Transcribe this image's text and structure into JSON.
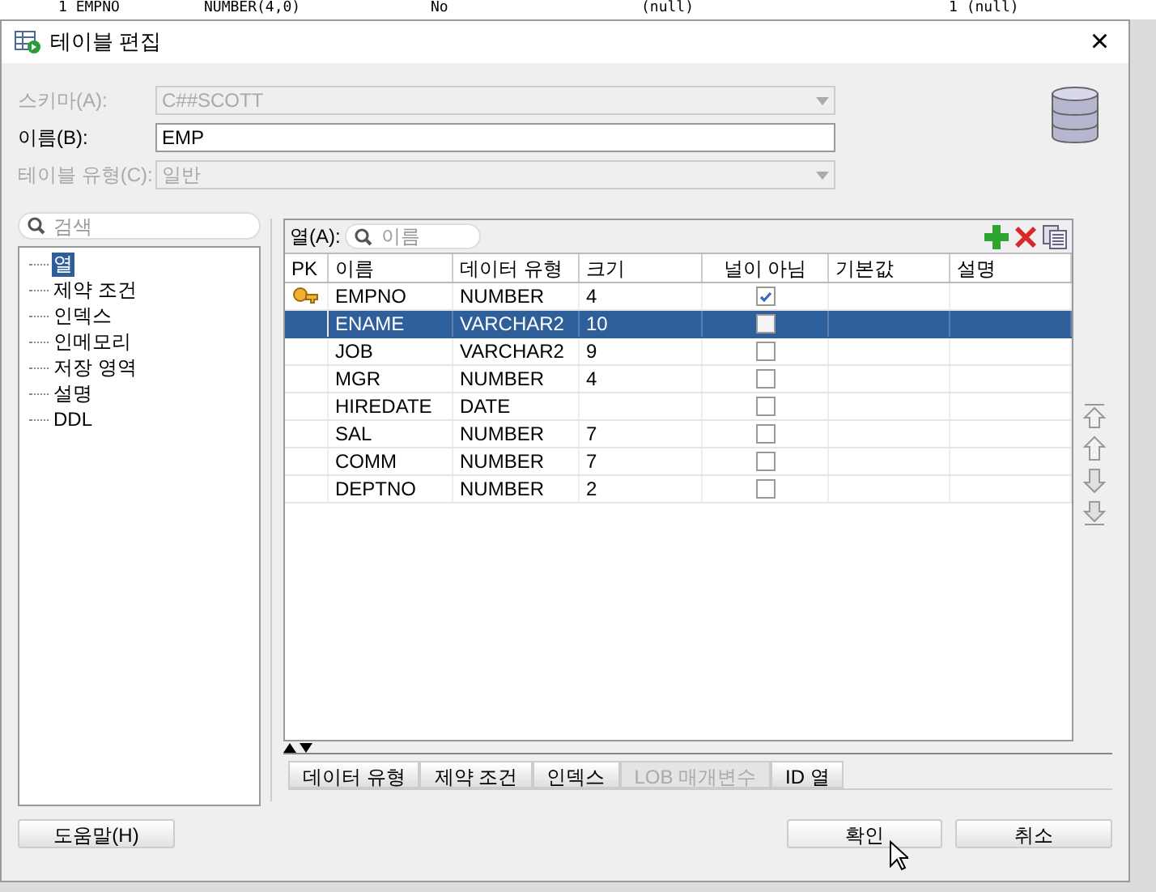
{
  "background_row": {
    "cells": [
      "1 EMPNO",
      "NUMBER(4,0)",
      "No",
      "(null)",
      "1 (null)"
    ]
  },
  "window": {
    "title": "테이블 편집",
    "close": "×"
  },
  "form": [
    {
      "label": "스키마(A):",
      "value": "C##SCOTT",
      "disabled": true,
      "kind": "dropdown"
    },
    {
      "label": "이름(B):",
      "value": "EMP",
      "disabled": false,
      "kind": "text"
    },
    {
      "label": "테이블 유형(C):",
      "value": "일반",
      "disabled": true,
      "kind": "dropdown"
    }
  ],
  "sidebar": {
    "search": {
      "placeholder": "검색"
    },
    "items": [
      {
        "label": "열",
        "selected": true
      },
      {
        "label": "제약 조건",
        "selected": false
      },
      {
        "label": "인덱스",
        "selected": false
      },
      {
        "label": "인메모리",
        "selected": false
      },
      {
        "label": "저장 영역",
        "selected": false
      },
      {
        "label": "설명",
        "selected": false
      },
      {
        "label": "DDL",
        "selected": false
      }
    ]
  },
  "columns_filter": {
    "label": "열(A):",
    "placeholder": "이름"
  },
  "table": {
    "columns": [
      "PK",
      "이름",
      "데이터 유형",
      "크기",
      "널이 아님",
      "기본값",
      "설명"
    ],
    "rows": [
      {
        "pk": true,
        "name": "EMPNO",
        "type": "NUMBER",
        "size": "4",
        "not_null": true,
        "selected": false
      },
      {
        "pk": false,
        "name": "ENAME",
        "type": "VARCHAR2",
        "size": "10",
        "not_null": false,
        "selected": true
      },
      {
        "pk": false,
        "name": "JOB",
        "type": "VARCHAR2",
        "size": "9",
        "not_null": false,
        "selected": false
      },
      {
        "pk": false,
        "name": "MGR",
        "type": "NUMBER",
        "size": "4",
        "not_null": false,
        "selected": false
      },
      {
        "pk": false,
        "name": "HIREDATE",
        "type": "DATE",
        "not_null": false,
        "selected": false
      },
      {
        "pk": false,
        "name": "SAL",
        "type": "NUMBER",
        "size": "7",
        "not_null": false,
        "selected": false
      },
      {
        "pk": false,
        "name": "COMM",
        "type": "NUMBER",
        "size": "7",
        "not_null": false,
        "selected": false
      },
      {
        "pk": false,
        "name": "DEPTNO",
        "type": "NUMBER",
        "size": "2",
        "not_null": false,
        "selected": false
      }
    ]
  },
  "bottom_tabs": [
    {
      "label": "데이터 유형",
      "disabled": false
    },
    {
      "label": "제약 조건",
      "disabled": false
    },
    {
      "label": "인덱스",
      "disabled": false
    },
    {
      "label": "LOB 매개변수",
      "disabled": true
    },
    {
      "label": "ID 열",
      "disabled": false
    }
  ],
  "buttons": {
    "help": "도움말(H)",
    "ok": "확인",
    "cancel": "취소"
  }
}
